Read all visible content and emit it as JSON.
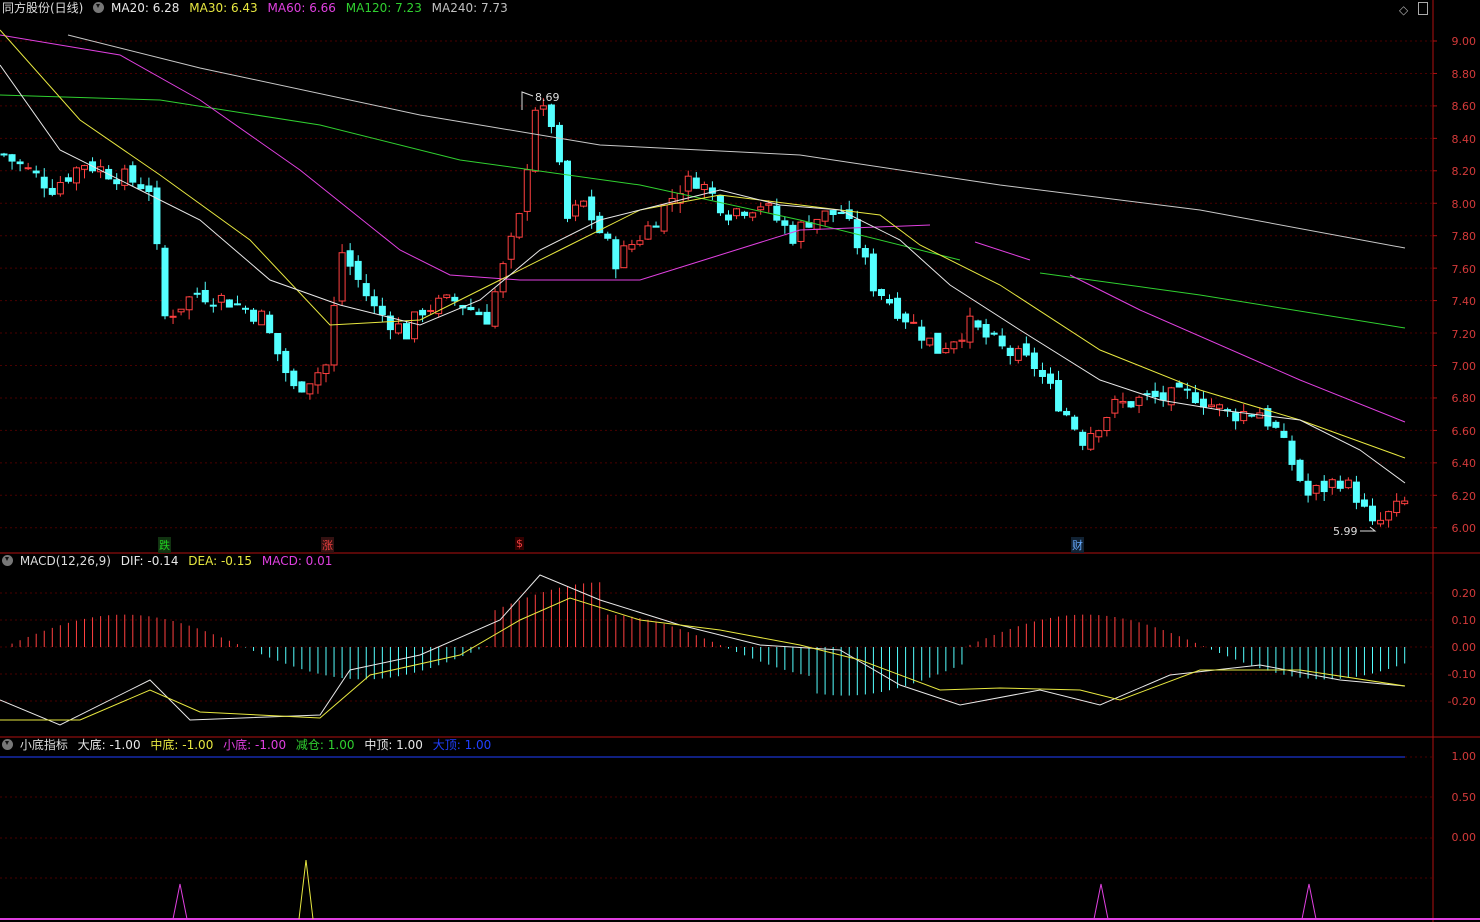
{
  "price_panel": {
    "stock": "同方股份(日线)",
    "ma": [
      {
        "label": "MA20: 6.28",
        "color": "#e8e8e8"
      },
      {
        "label": "MA30: 6.43",
        "color": "#e8e840"
      },
      {
        "label": "MA60: 6.66",
        "color": "#e040e0"
      },
      {
        "label": "MA120: 7.23",
        "color": "#30d030"
      },
      {
        "label": "MA240: 7.73",
        "color": "#c0c0c0"
      }
    ],
    "axis": [
      "9.00",
      "8.80",
      "8.60",
      "8.40",
      "8.20",
      "8.00",
      "7.80",
      "7.60",
      "7.40",
      "7.20",
      "7.00",
      "6.80",
      "6.60",
      "6.40",
      "6.20",
      "6.00"
    ],
    "high_label": "8.69",
    "low_label": "5.99",
    "markers": [
      {
        "text": "跌",
        "color": "#20d020",
        "bg": "#113311"
      },
      {
        "text": "涨",
        "color": "#ee4040",
        "bg": "#331111"
      },
      {
        "text": "$",
        "color": "#ee4040",
        "bg": "#330000"
      },
      {
        "text": "财",
        "color": "#66aaff",
        "bg": "#112233"
      }
    ]
  },
  "macd_panel": {
    "title": "MACD(12,26,9)",
    "dif": "DIF: -0.14",
    "dea": "DEA: -0.15",
    "macd": "MACD: 0.01",
    "axis": [
      "0.20",
      "0.10",
      "0.00",
      "-0.10",
      "-0.20"
    ]
  },
  "indicator_panel": {
    "title": "小底指标",
    "items": [
      {
        "label": "大底: -1.00",
        "color": "#e8e8e8"
      },
      {
        "label": "中底: -1.00",
        "color": "#e8e840"
      },
      {
        "label": "小底: -1.00",
        "color": "#e040e0"
      },
      {
        "label": "减仓: 1.00",
        "color": "#30d030"
      },
      {
        "label": "中顶: 1.00",
        "color": "#e8e8e8"
      },
      {
        "label": "大顶: 1.00",
        "color": "#2040ff"
      }
    ],
    "axis": [
      "1.00",
      "0.50",
      "0.00"
    ]
  },
  "colors": {
    "up": "#ff4040",
    "down": "#54ffff",
    "grid": "#4a0000",
    "border": "#b01010"
  }
}
